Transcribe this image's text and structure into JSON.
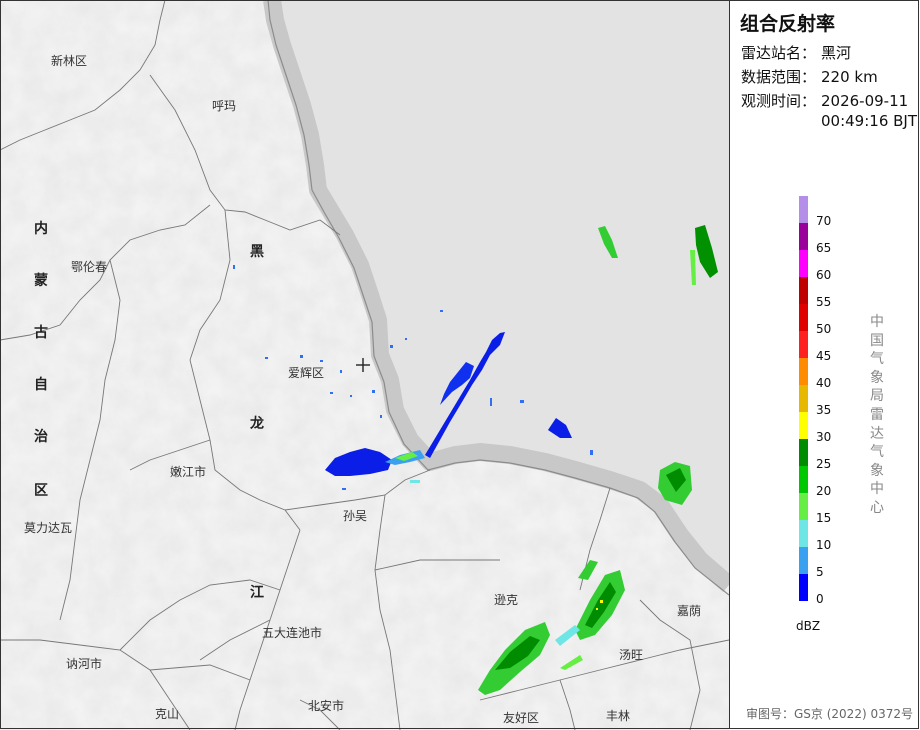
{
  "panel": {
    "title": "组合反射率",
    "station_label": "雷达站名：",
    "station_value": "黑河",
    "range_label": "数据范围：",
    "range_value": "220 km",
    "time_label": "观测时间：",
    "time_value": "2026-09-11\n00:49:16 BJT",
    "credit": "中国气象局雷达气象中心",
    "unit": "dBZ",
    "approval": "审图号：GS京 (2022) 0372号"
  },
  "legend": [
    {
      "label": "70",
      "color": "#b48ee8"
    },
    {
      "label": "65",
      "color": "#9a009a"
    },
    {
      "label": "60",
      "color": "#ff00ff"
    },
    {
      "label": "55",
      "color": "#c00000"
    },
    {
      "label": "50",
      "color": "#e00000"
    },
    {
      "label": "45",
      "color": "#ff2020"
    },
    {
      "label": "40",
      "color": "#ff8c00"
    },
    {
      "label": "35",
      "color": "#e6b800"
    },
    {
      "label": "30",
      "color": "#ffff00"
    },
    {
      "label": "25",
      "color": "#008c00"
    },
    {
      "label": "20",
      "color": "#00c800"
    },
    {
      "label": "15",
      "color": "#66ee44"
    },
    {
      "label": "10",
      "color": "#6ee6e6"
    },
    {
      "label": "5",
      "color": "#3aa0f0"
    },
    {
      "label": "0",
      "color": "#0000ff"
    }
  ],
  "map": {
    "places": {
      "xinlin": "新林区",
      "huma": "呼玛",
      "elunchun": "鄂伦春",
      "aihui": "爱辉区",
      "nenjiang": "嫩江市",
      "sunwu": "孙吴",
      "molidawa": "莫力达瓦",
      "xunke": "逊克",
      "wudalianchi": "五大连池市",
      "jiayin": "嘉荫",
      "nehe": "讷河市",
      "tangwang": "汤旺",
      "kedong": "克山",
      "beian": "北安市",
      "youhao": "友好区",
      "fenglin": "丰林"
    },
    "province_nm": [
      "内",
      "蒙",
      "古",
      "自",
      "治",
      "区"
    ],
    "province_hlj": [
      "黑",
      "龙",
      "江"
    ]
  }
}
